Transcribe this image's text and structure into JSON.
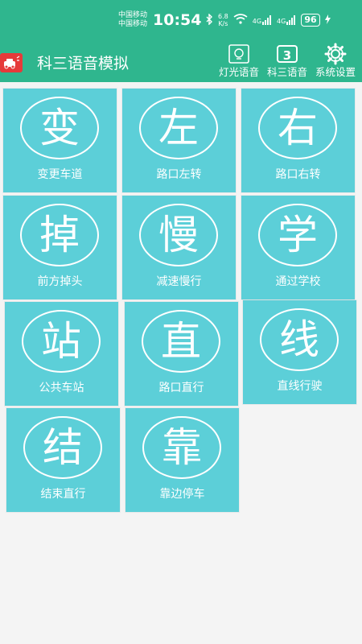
{
  "status_bar": {
    "carrier_1": "中国移动",
    "carrier_2": "中国移动",
    "time": "10:54",
    "speed_value": "6.8",
    "speed_unit": "K/s",
    "net_1": "4G",
    "net_2": "4G",
    "battery": "96"
  },
  "app_bar": {
    "title": "科三语音模拟",
    "actions": [
      {
        "label": "灯光语音",
        "icon": "light-voice-icon"
      },
      {
        "label": "科三语音",
        "icon_text": "3"
      },
      {
        "label": "系统设置",
        "icon": "gear-icon"
      }
    ]
  },
  "colors": {
    "header": "#2fb68e",
    "tile": "#5ccfd8",
    "background": "#f4f4f4",
    "app_icon": "#e63a3a"
  },
  "tiles": [
    {
      "glyph": "变",
      "label": "变更车道"
    },
    {
      "glyph": "左",
      "label": "路口左转"
    },
    {
      "glyph": "右",
      "label": "路口右转"
    },
    {
      "glyph": "掉",
      "label": "前方掉头"
    },
    {
      "glyph": "慢",
      "label": "减速慢行"
    },
    {
      "glyph": "学",
      "label": "通过学校"
    },
    {
      "glyph": "站",
      "label": "公共车站"
    },
    {
      "glyph": "直",
      "label": "路口直行"
    },
    {
      "glyph": "线",
      "label": "直线行驶"
    },
    {
      "glyph": "结",
      "label": "结束直行"
    },
    {
      "glyph": "靠",
      "label": "靠边停车"
    }
  ]
}
